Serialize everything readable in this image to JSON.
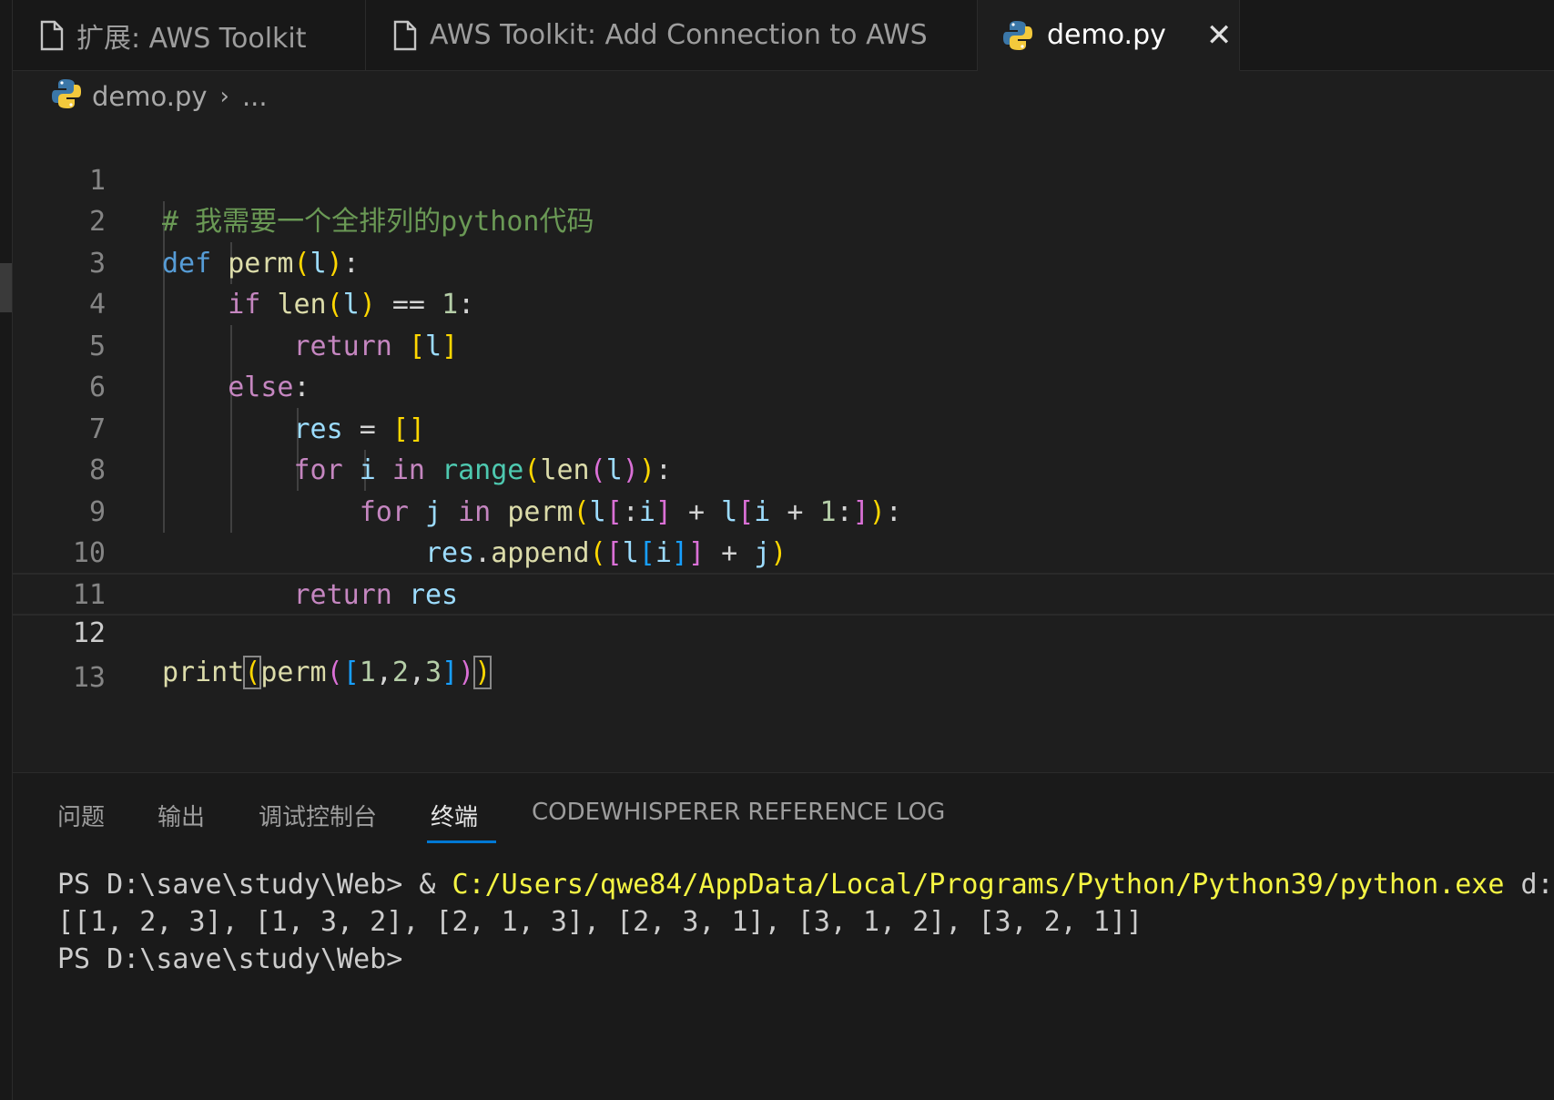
{
  "tabs": [
    {
      "label": "扩展: AWS Toolkit",
      "icon": "file-icon"
    },
    {
      "label": "AWS Toolkit: Add Connection to AWS",
      "icon": "file-icon"
    },
    {
      "label": "demo.py",
      "icon": "python-icon",
      "close": "✕"
    }
  ],
  "breadcrumb": {
    "file": "demo.py",
    "sep": "›",
    "rest": "..."
  },
  "editor": {
    "line_numbers": [
      "1",
      "2",
      "3",
      "4",
      "5",
      "6",
      "7",
      "8",
      "9",
      "10",
      "11",
      "12",
      "13"
    ],
    "current_line": "12"
  },
  "panel": {
    "tabs": [
      "问题",
      "输出",
      "调试控制台",
      "终端",
      "CODEWHISPERER REFERENCE LOG"
    ],
    "active_tab": "终端",
    "terminal": {
      "line1_prompt": "PS D:\\save\\study\\Web> & ",
      "line1_path": "C:/Users/qwe84/AppData/Local/Programs/Python/Python39/python.exe",
      "line1_rest": " d:/",
      "line2": "[[1, 2, 3], [1, 3, 2], [2, 1, 3], [2, 3, 1], [3, 1, 2], [3, 2, 1]]",
      "line3": "PS D:\\save\\study\\Web>"
    }
  },
  "colors": {
    "accent": "#0078d4",
    "comment": "#6a9955",
    "keyword": "#569cd6",
    "control": "#c586c0",
    "function": "#dcdcaa",
    "variable": "#9cdcfe",
    "number": "#b5cea8",
    "bracket1": "#ffd700",
    "bracket2": "#da70d6",
    "bracket3": "#179fff"
  }
}
